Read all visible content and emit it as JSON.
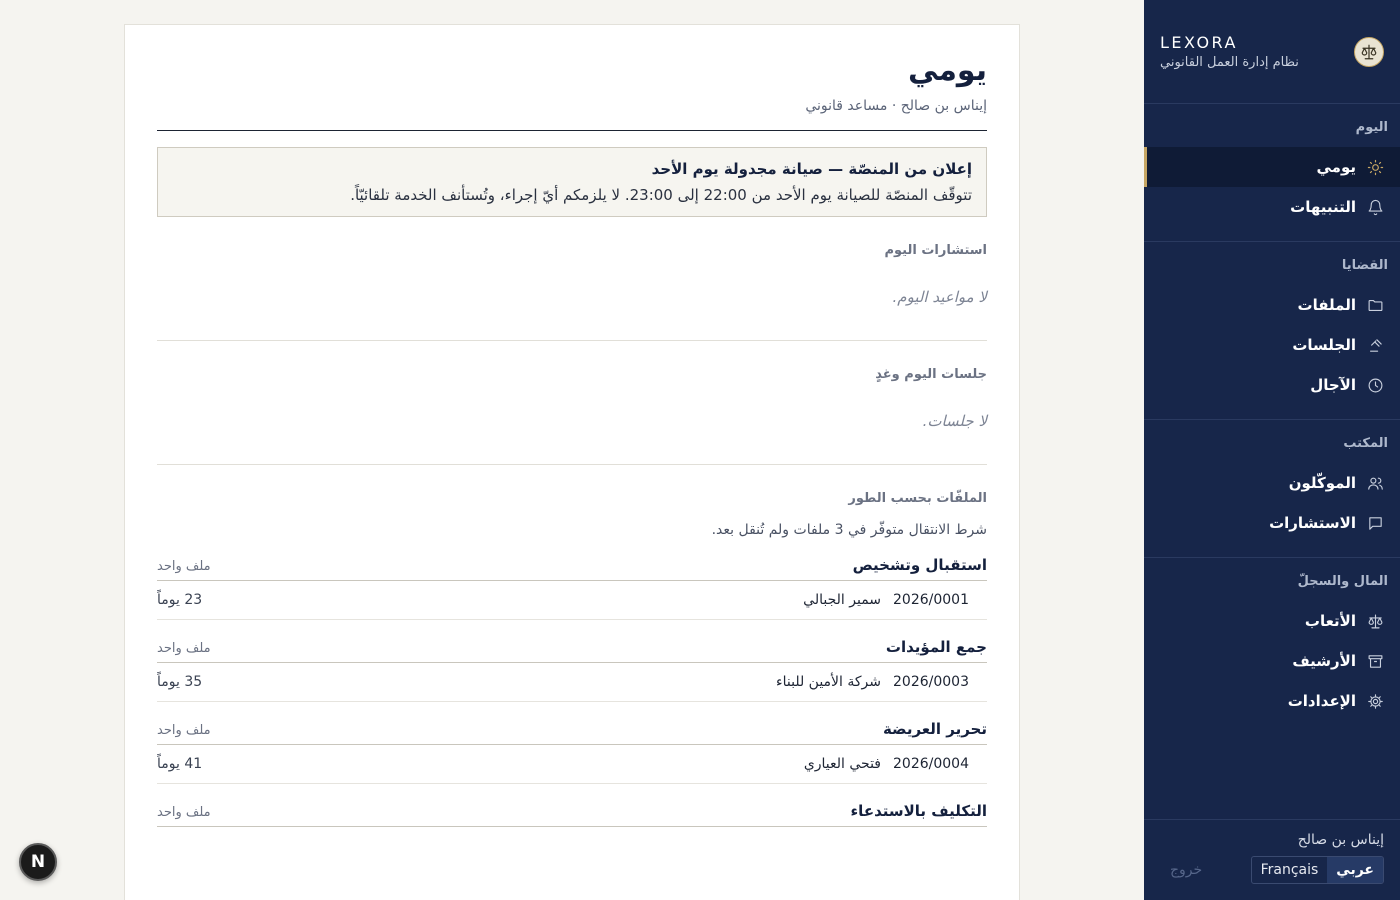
{
  "brand": {
    "name": "LEXORA",
    "subtitle": "نظام إدارة العمل القانوني"
  },
  "sidebar": {
    "groups": [
      {
        "title": "اليوم",
        "items": [
          {
            "label": "يومي",
            "icon": "sun-icon",
            "active": true
          },
          {
            "label": "التنبيهات",
            "icon": "bell-icon",
            "active": false
          }
        ]
      },
      {
        "title": "القضايا",
        "items": [
          {
            "label": "الملفات",
            "icon": "folder-icon",
            "active": false
          },
          {
            "label": "الجلسات",
            "icon": "gavel-icon",
            "active": false
          },
          {
            "label": "الآجال",
            "icon": "clock-icon",
            "active": false
          }
        ]
      },
      {
        "title": "المكتب",
        "items": [
          {
            "label": "الموكّلون",
            "icon": "users-icon",
            "active": false
          },
          {
            "label": "الاستشارات",
            "icon": "chat-icon",
            "active": false
          }
        ]
      },
      {
        "title": "المال والسجلّ",
        "items": [
          {
            "label": "الأتعاب",
            "icon": "scales-icon",
            "active": false
          },
          {
            "label": "الأرشيف",
            "icon": "archive-icon",
            "active": false
          },
          {
            "label": "الإعدادات",
            "icon": "gear-icon",
            "active": false
          }
        ]
      }
    ],
    "footer": {
      "user_name": "إيناس بن صالح",
      "lang_ar": "عربي",
      "lang_fr": "Français",
      "logout": "خروج"
    }
  },
  "main": {
    "title": "يومي",
    "subtitle": "إيناس بن صالح · مساعد قانوني",
    "announcement": {
      "title": "إعلان من المنصّة — صيانة مجدولة يوم الأحد",
      "body": "تتوقّف المنصّة للصيانة يوم الأحد من 22:00 إلى 23:00. لا يلزمكم أيّ إجراء، وتُستأنف الخدمة تلقائيّاً."
    },
    "consultations": {
      "title": "استشارات اليوم",
      "empty": "لا مواعيد اليوم."
    },
    "hearings": {
      "title": "جلسات اليوم وغدٍ",
      "empty": "لا جلسات."
    },
    "stages": {
      "title": "الملفّات بحسب الطور",
      "description": "شرط الانتقال متوفّر في 3 ملفات ولم تُنقل بعد.",
      "list": [
        {
          "name": "استقبال وتشخيص",
          "count": "ملف واحد",
          "files": [
            {
              "ref": "2026/0001",
              "client": "سمير الجبالي",
              "days": "23 يوماً"
            }
          ]
        },
        {
          "name": "جمع المؤيدات",
          "count": "ملف واحد",
          "files": [
            {
              "ref": "2026/0003",
              "client": "شركة الأمين للبناء",
              "days": "35 يوماً"
            }
          ]
        },
        {
          "name": "تحرير العريضة",
          "count": "ملف واحد",
          "files": [
            {
              "ref": "2026/0004",
              "client": "فتحي العياري",
              "days": "41 يوماً"
            }
          ]
        },
        {
          "name": "التكليف بالاستدعاء",
          "count": "ملف واحد",
          "files": []
        }
      ]
    }
  },
  "fab": {
    "label": "N"
  }
}
